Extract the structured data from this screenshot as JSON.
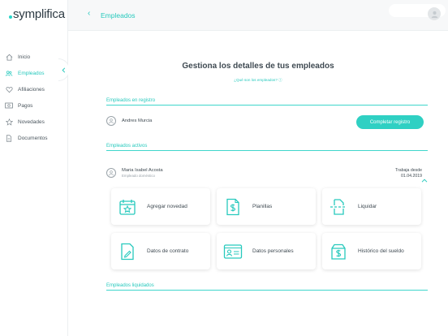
{
  "app": {
    "logo_text": "symplifica",
    "accent": "#2fd0c3"
  },
  "sidebar": {
    "items": [
      {
        "label": "Inicio",
        "icon": "home-icon"
      },
      {
        "label": "Empleados",
        "icon": "users-icon",
        "active": true
      },
      {
        "label": "Afiliaciones",
        "icon": "heart-icon"
      },
      {
        "label": "Pagos",
        "icon": "cash-icon"
      },
      {
        "label": "Novedades",
        "icon": "star-icon"
      },
      {
        "label": "Documentos",
        "icon": "document-icon"
      }
    ]
  },
  "header": {
    "back": "‹",
    "title": "Empleados"
  },
  "main": {
    "title": "Gestiona los detalles de tus empleados",
    "subtitle": "¿Qué son los empleados?  ⓘ",
    "sections": {
      "registro": "Empleados en registro",
      "activos": "Empleados activos",
      "liquidados": "Empleados liquidados"
    },
    "registro_employee": {
      "name": "Andres Murcia",
      "action": "Completar registro"
    },
    "active_employee": {
      "name": "Maria Isabel Acosta",
      "role": "Empleado doméstico",
      "since_label": "Trabaja desde",
      "since_date": "01.04.2019"
    },
    "tiles": [
      {
        "label": "Agregar novedad",
        "icon": "calendar-star-icon"
      },
      {
        "label": "Planillas",
        "icon": "invoice-dollar-icon"
      },
      {
        "label": "Liquidar",
        "icon": "scan-document-icon"
      },
      {
        "label": "Datos de contrato",
        "icon": "contract-pen-icon"
      },
      {
        "label": "Datos personales",
        "icon": "id-card-icon"
      },
      {
        "label": "Histórico del sueldo",
        "icon": "salary-box-icon"
      }
    ]
  }
}
